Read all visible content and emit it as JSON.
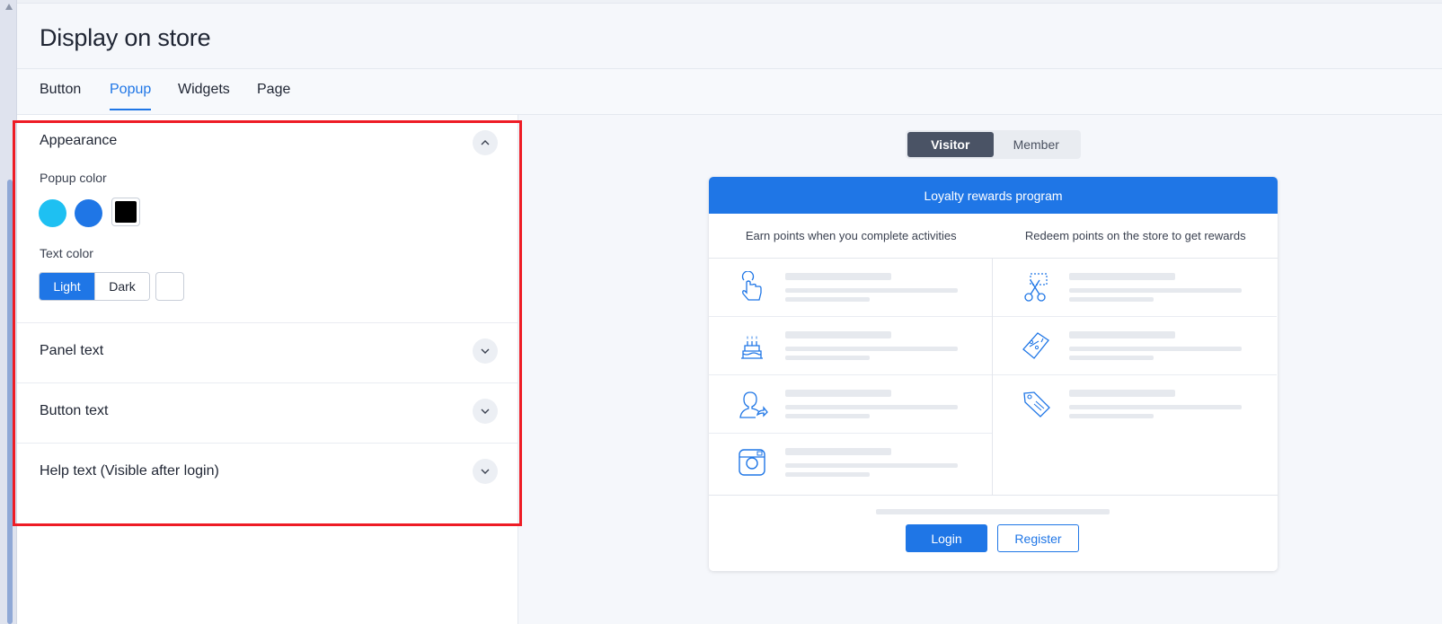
{
  "page": {
    "title": "Display on store"
  },
  "tabs": [
    {
      "label": "Button"
    },
    {
      "label": "Popup",
      "active": true
    },
    {
      "label": "Widgets"
    },
    {
      "label": "Page"
    }
  ],
  "settings": {
    "appearance": {
      "title": "Appearance",
      "popup_color_label": "Popup color",
      "popup_colors": [
        "#1ec0f2",
        "#1f76e6",
        "#000000"
      ],
      "selected_popup_color": "#000000",
      "text_color_label": "Text color",
      "text_color_options": [
        "Light",
        "Dark"
      ],
      "text_color_selected": "Light"
    },
    "sections": [
      {
        "title": "Panel text"
      },
      {
        "title": "Button text"
      },
      {
        "title": "Help text (Visible after login)"
      }
    ]
  },
  "preview": {
    "toggle": [
      "Visitor",
      "Member"
    ],
    "toggle_selected": "Visitor",
    "header": "Loyalty rewards program",
    "earn_heading": "Earn points when you complete activities",
    "redeem_heading": "Redeem points on the store to get rewards",
    "earn_icons": [
      "tap-hand-icon",
      "birthday-cake-icon",
      "user-share-icon",
      "instagram-icon"
    ],
    "redeem_icons": [
      "coupon-scissors-icon",
      "percent-voucher-icon",
      "free-tag-icon"
    ],
    "login_label": "Login",
    "register_label": "Register"
  },
  "colors": {
    "accent": "#1f76e6",
    "highlight": "#ee1c25"
  }
}
